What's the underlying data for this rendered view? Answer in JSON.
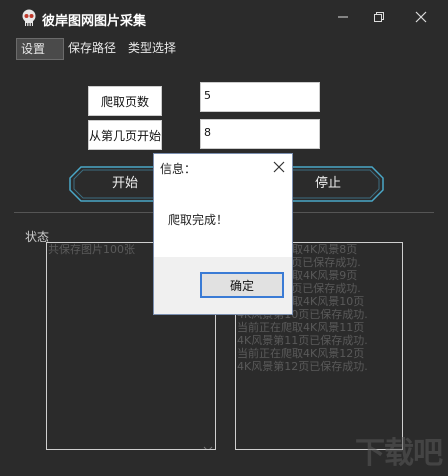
{
  "window": {
    "title": "彼岸图网图片采集",
    "icon": "skull-icon"
  },
  "menu": {
    "items": [
      "设置",
      "保存路径",
      "类型选择"
    ]
  },
  "form": {
    "pages_label": "爬取页数",
    "pages_value": "5",
    "start_label": "从第几页开始",
    "start_value": "8"
  },
  "buttons": {
    "start": "开始",
    "stop": "停止"
  },
  "status": {
    "label": "状态",
    "left_log": [
      "共保存图片100张"
    ],
    "right_log": [
      "当前正在爬取4K风景8页",
      "4K风景第8页已保存成功.",
      "当前正在爬取4K风景9页",
      "4K风景第9页已保存成功.",
      "当前正在爬取4K风景10页",
      "4K风景第10页已保存成功.",
      "当前正在爬取4K风景11页",
      "4K风景第11页已保存成功.",
      "当前正在爬取4K风景12页",
      "4K风景第12页已保存成功."
    ]
  },
  "dialog": {
    "title": "信息：",
    "message": "爬取完成！",
    "ok": "确定"
  },
  "watermark": "下载吧",
  "colors": {
    "background": "#2b2b2b",
    "hex_border": "#4aa8c8",
    "dialog_accent": "#3a7bd5"
  }
}
